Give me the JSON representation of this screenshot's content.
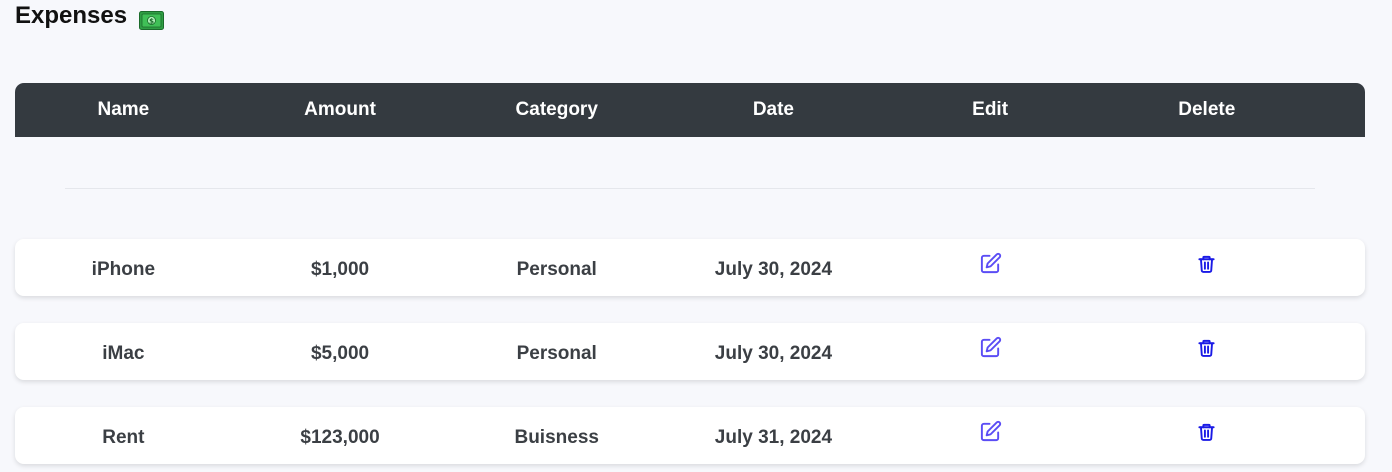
{
  "page": {
    "title": "Expenses",
    "title_icon": "money-with-wings-icon"
  },
  "table": {
    "headers": [
      "Name",
      "Amount",
      "Category",
      "Date",
      "Edit",
      "Delete"
    ],
    "rows": [
      {
        "name": "iPhone",
        "amount": "$1,000",
        "category": "Personal",
        "date": "July 30, 2024"
      },
      {
        "name": "iMac",
        "amount": "$5,000",
        "category": "Personal",
        "date": "July 30, 2024"
      },
      {
        "name": "Rent",
        "amount": "$123,000",
        "category": "Buisness",
        "date": "July 31, 2024"
      }
    ],
    "edit_icon": "edit-icon",
    "delete_icon": "trash-icon"
  },
  "colors": {
    "header_bg": "#343a40",
    "edit_icon": "#5b4df5",
    "delete_icon": "#1a1ae6",
    "page_bg": "#f7f8fc"
  }
}
